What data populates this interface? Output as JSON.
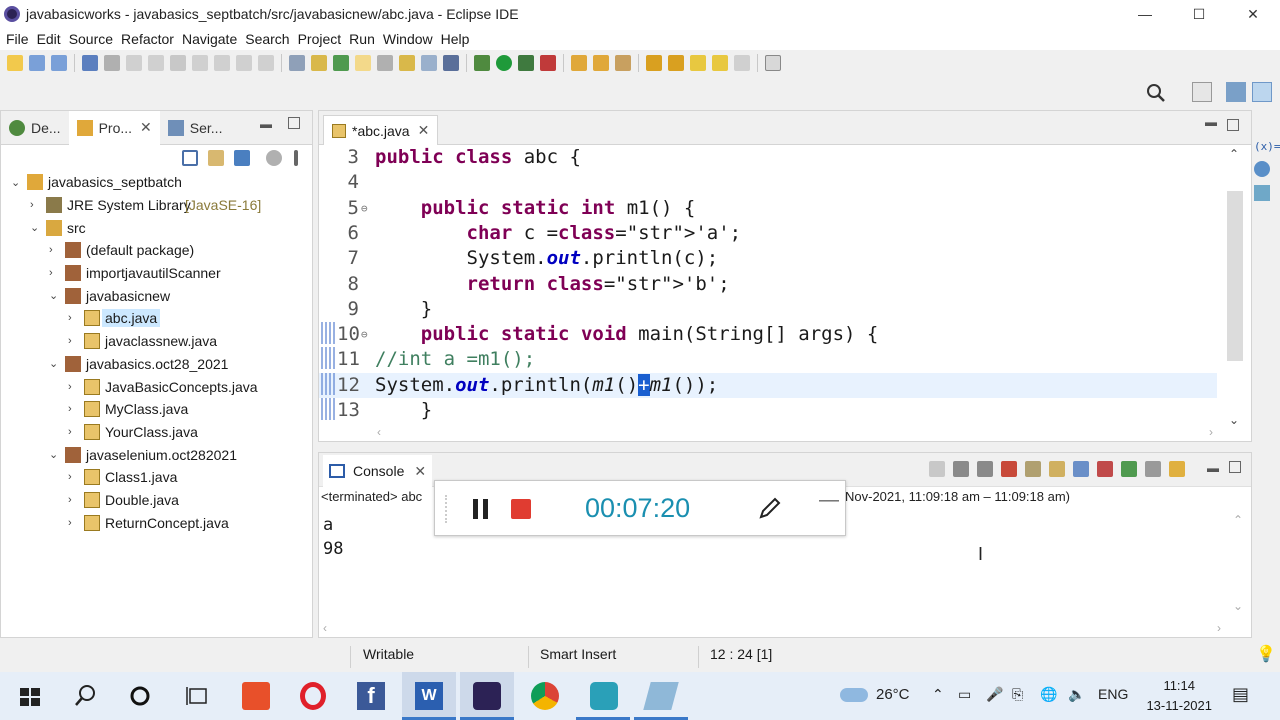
{
  "window": {
    "title": "javabasicworks - javabasics_septbatch/src/javabasicnew/abc.java - Eclipse IDE",
    "controls": {
      "minimize": "—",
      "maximize": "☐",
      "close": "✕"
    }
  },
  "menu": [
    "File",
    "Edit",
    "Source",
    "Refactor",
    "Navigate",
    "Search",
    "Project",
    "Run",
    "Window",
    "Help"
  ],
  "left_panel": {
    "tabs": [
      {
        "label": "De...",
        "icon": "debug-bug-icon"
      },
      {
        "label": "Pro...",
        "icon": "project-folder-icon"
      },
      {
        "label": "Ser...",
        "icon": "servers-icon"
      }
    ],
    "tree": [
      {
        "label": "javabasics_septbatch",
        "level": 0,
        "arrow": "⌄",
        "icon": "project-icon"
      },
      {
        "label": "JRE System Library",
        "note": "[JavaSE-16]",
        "level": 1,
        "arrow": "›",
        "icon": "library-icon"
      },
      {
        "label": "src",
        "level": 1,
        "arrow": "⌄",
        "icon": "source-folder-icon"
      },
      {
        "label": "(default package)",
        "level": 2,
        "arrow": "›",
        "icon": "package-icon"
      },
      {
        "label": "importjavautilScanner",
        "level": 2,
        "arrow": "›",
        "icon": "package-icon"
      },
      {
        "label": "javabasicnew",
        "level": 2,
        "arrow": "⌄",
        "icon": "package-icon"
      },
      {
        "label": "abc.java",
        "level": 3,
        "arrow": "›",
        "icon": "java-file-icon",
        "selected": true
      },
      {
        "label": "javaclassnew.java",
        "level": 3,
        "arrow": "›",
        "icon": "java-file-icon"
      },
      {
        "label": "javabasics.oct28_2021",
        "level": 2,
        "arrow": "⌄",
        "icon": "package-icon"
      },
      {
        "label": "JavaBasicConcepts.java",
        "level": 3,
        "arrow": "›",
        "icon": "java-file-icon"
      },
      {
        "label": "MyClass.java",
        "level": 3,
        "arrow": "›",
        "icon": "java-file-icon"
      },
      {
        "label": "YourClass.java",
        "level": 3,
        "arrow": "›",
        "icon": "java-file-icon"
      },
      {
        "label": "javaselenium.oct282021",
        "level": 2,
        "arrow": "⌄",
        "icon": "package-icon"
      },
      {
        "label": "Class1.java",
        "level": 3,
        "arrow": "›",
        "icon": "java-file-icon"
      },
      {
        "label": "Double.java",
        "level": 3,
        "arrow": "›",
        "icon": "java-file-icon"
      },
      {
        "label": "ReturnConcept.java",
        "level": 3,
        "arrow": "›",
        "icon": "java-file-icon"
      }
    ]
  },
  "editor": {
    "tab_label": "*abc.java",
    "lines": [
      {
        "num": "3",
        "text": "public class abc {"
      },
      {
        "num": "4",
        "text": ""
      },
      {
        "num": "5",
        "text": "    public static int m1() {"
      },
      {
        "num": "6",
        "text": "        char c ='a';"
      },
      {
        "num": "7",
        "text": "        System.out.println(c);"
      },
      {
        "num": "8",
        "text": "        return 'b';"
      },
      {
        "num": "9",
        "text": "    }"
      },
      {
        "num": "10",
        "text": "    public static void main(String[] args) {"
      },
      {
        "num": "11",
        "text": "//int a =m1();"
      },
      {
        "num": "12",
        "text": "System.out.println(m1()+m1());"
      },
      {
        "num": "13",
        "text": "    }"
      }
    ]
  },
  "console": {
    "tab_label": "Console",
    "terminated_prefix": "<terminated> abc",
    "terminated_suffix": "Nov-2021, 11:09:18 am – 11:09:18 am)",
    "output": [
      "a",
      "98"
    ]
  },
  "recorder": {
    "time": "00:07:20"
  },
  "status": {
    "writable": "Writable",
    "insert_mode": "Smart Insert",
    "position": "12 : 24 [1]"
  },
  "taskbar": {
    "temperature": "26°C",
    "language": "ENG",
    "time": "11:14",
    "date": "13-11-2021"
  }
}
